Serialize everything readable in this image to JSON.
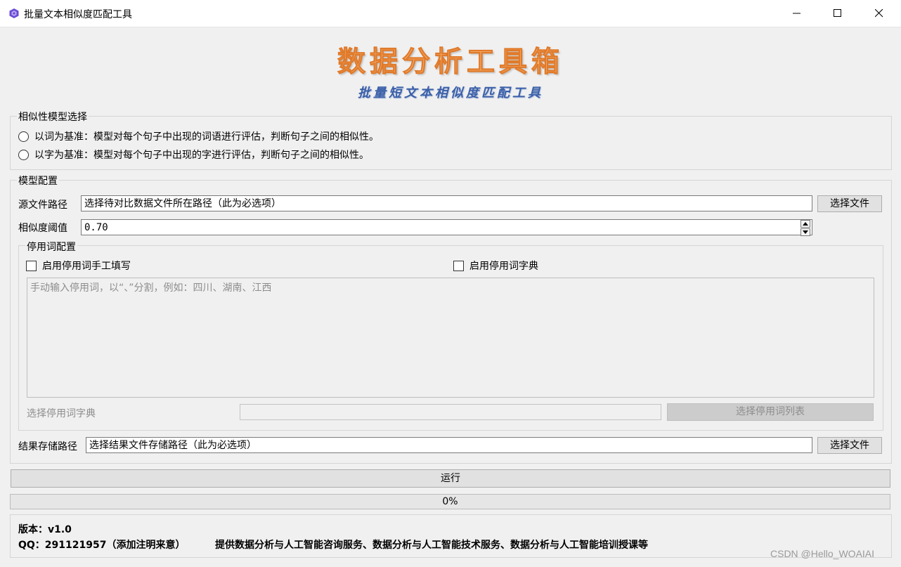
{
  "window": {
    "title": "批量文本相似度匹配工具",
    "controls": [
      "minimize-icon",
      "maximize-icon",
      "close-icon"
    ]
  },
  "banner": {
    "title": "数据分析工具箱",
    "subtitle": "批量短文本相似度匹配工具"
  },
  "model_select": {
    "legend": "相似性模型选择",
    "options": [
      {
        "label": "以词为基准：模型对每个句子中出现的词语进行评估，判断句子之间的相似性。",
        "selected": false
      },
      {
        "label": "以字为基准：模型对每个句子中出现的字进行评估，判断句子之间的相似性。",
        "selected": false
      }
    ]
  },
  "model_config": {
    "legend": "模型配置",
    "source_label": "源文件路径",
    "source_value": "选择待对比数据文件所在路径（此为必选项）",
    "source_button": "选择文件",
    "threshold_label": "相似度阈值",
    "threshold_value": "0.70",
    "stopwords": {
      "legend": "停用词配置",
      "manual_checkbox": "启用停用词手工填写",
      "dict_checkbox": "启用停用词字典",
      "textarea_placeholder": "手动输入停用词，以“、”分割，例如：四川、湖南、江西",
      "dict_label": "选择停用词字典",
      "dict_value": "",
      "dict_button": "选择停用词列表"
    },
    "result_label": "结果存储路径",
    "result_value": "选择结果文件存储路径（此为必选项）",
    "result_button": "选择文件"
  },
  "run_button": "运行",
  "progress": {
    "value": 0,
    "label": "0%"
  },
  "footer": {
    "version": "版本：v1.0",
    "qq": "QQ：291121957（添加注明来意）",
    "services": "提供数据分析与人工智能咨询服务、数据分析与人工智能技术服务、数据分析与人工智能培训授课等"
  },
  "watermark": "CSDN @Hello_WOAIAI"
}
